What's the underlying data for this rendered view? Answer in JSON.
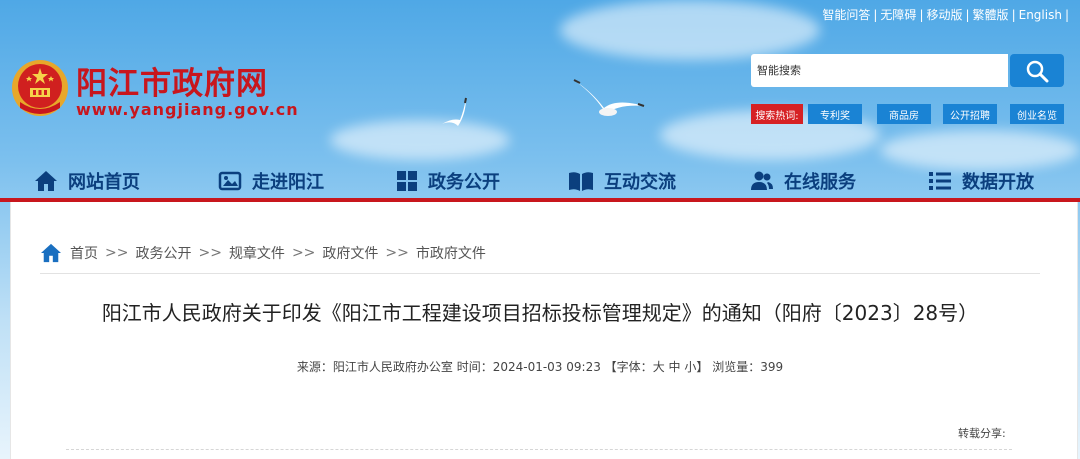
{
  "top_links": [
    "智能问答",
    "无障碍",
    "移动版",
    "繁體版",
    "English"
  ],
  "site": {
    "title": "阳江市政府网",
    "url": "www.yangjiang.gov.cn"
  },
  "search": {
    "placeholder": "智能搜索"
  },
  "hot": {
    "label": "搜索热词:",
    "items": [
      "专利奖",
      "商品房",
      "公开招聘",
      "创业名览"
    ]
  },
  "nav": {
    "items": [
      {
        "label": "网站首页",
        "icon": "home-icon"
      },
      {
        "label": "走进阳江",
        "icon": "photo-icon"
      },
      {
        "label": "政务公开",
        "icon": "grid-icon"
      },
      {
        "label": "互动交流",
        "icon": "book-icon"
      },
      {
        "label": "在线服务",
        "icon": "users-icon"
      },
      {
        "label": "数据开放",
        "icon": "list-icon"
      }
    ]
  },
  "breadcrumb": {
    "items": [
      "首页",
      "政务公开",
      "规章文件",
      "政府文件",
      "市政府文件"
    ],
    "separator": ">>"
  },
  "article": {
    "title": "阳江市人民政府关于印发《阳江市工程建设项目招标投标管理规定》的通知（阳府〔2023〕28号）",
    "meta_source_label": "来源：",
    "meta_source": "阳江市人民政府办公室",
    "meta_time_label": "时间：",
    "meta_time": "2024-01-03 09:23",
    "meta_font_label": "【字体：",
    "font_sizes": [
      "大",
      "中",
      "小"
    ],
    "meta_font_end": "】",
    "meta_views_label": "浏览量：",
    "meta_views": "399",
    "share_label": "转载分享:"
  },
  "colors": {
    "brand_red": "#c8161d",
    "nav_blue": "#0b3f7e",
    "button_blue": "#1a83d4"
  }
}
